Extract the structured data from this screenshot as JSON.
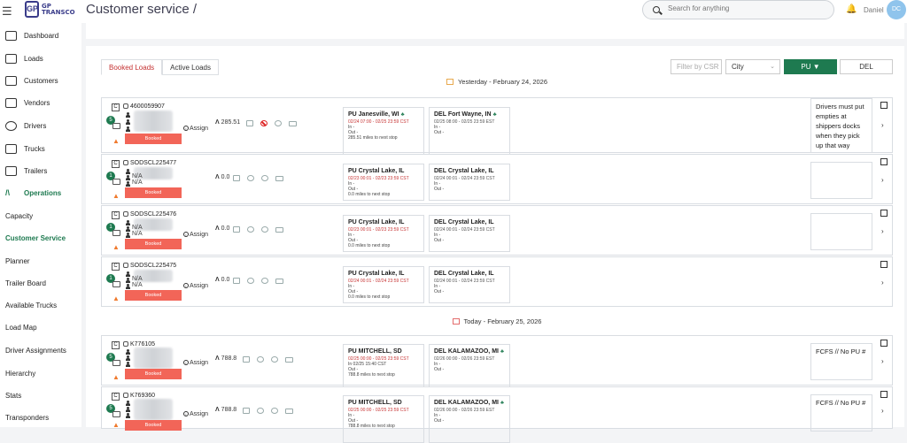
{
  "header": {
    "logo_letters": "GP",
    "logo_text_1": "GP",
    "logo_text_2": "TRANSCO",
    "page_title": "Customer service /",
    "search_placeholder": "Search for anything",
    "username": "Daniel",
    "avatar_initials": "DC"
  },
  "sidebar": {
    "items": [
      {
        "label": "Dashboard",
        "icon": "dashboard-icon"
      },
      {
        "label": "Loads",
        "icon": "loads-icon"
      },
      {
        "label": "Customers",
        "icon": "customers-icon"
      },
      {
        "label": "Vendors",
        "icon": "vendors-icon"
      },
      {
        "label": "Drivers",
        "icon": "drivers-icon"
      },
      {
        "label": "Trucks",
        "icon": "truck-icon"
      },
      {
        "label": "Trailers",
        "icon": "trailer-icon"
      },
      {
        "label": "Operations",
        "icon": "operations-icon"
      }
    ],
    "sub_items": [
      {
        "label": "Capacity"
      },
      {
        "label": "Customer Service"
      },
      {
        "label": "Planner"
      },
      {
        "label": "Trailer Board"
      },
      {
        "label": "Available Trucks"
      },
      {
        "label": "Load Map"
      },
      {
        "label": "Driver Assignments"
      },
      {
        "label": "Hierarchy"
      },
      {
        "label": "Stats"
      },
      {
        "label": "Transponders"
      }
    ]
  },
  "tabs": [
    {
      "label": "Booked Loads",
      "active": true
    },
    {
      "label": "Active Loads",
      "active": false
    }
  ],
  "filters": {
    "csr_placeholder": "Filter by CSR",
    "city_value": "City",
    "pu_label": "PU ▼",
    "del_label": "DEL"
  },
  "days": {
    "yesterday": "Yesterday - February 24, 2026",
    "today": "Today - February 25, 2026"
  },
  "rows": [
    {
      "id": "4600059907",
      "na": "",
      "badge": "5",
      "status": "Booked",
      "assign": "Assign",
      "miles": "285.51",
      "pu": {
        "title": "PU Janesville, WI",
        "time": "02/24 07:00 - 02/25 23:59 CST",
        "l1": "In -",
        "l2": "Out -",
        "l3": "285.51 miles to next stop"
      },
      "del": {
        "title": "DEL Fort Wayne, IN",
        "time": "02/25 08:00 - 02/25 23:59 EST",
        "l1": "In -",
        "l2": "Out -"
      },
      "note": "Drivers must put empties at shippers docks when they pick up that way"
    },
    {
      "id": "SODSCL225477",
      "na": "N/A",
      "badge": "1",
      "status": "Booked",
      "assign": "",
      "miles": "0.0",
      "pu": {
        "title": "PU Crystal Lake, IL",
        "time": "02/23 00:01 - 02/23 23:59 CST",
        "l1": "In -",
        "l2": "Out -",
        "l3": "0.0 miles to next stop"
      },
      "del": {
        "title": "DEL Crystal Lake, IL",
        "time": "02/24 00:01 - 02/24 23:59 CST",
        "l1": "In -",
        "l2": "Out -"
      },
      "note": ""
    },
    {
      "id": "SODSCL225476",
      "na": "N/A",
      "badge": "1",
      "status": "Booked",
      "assign": "Assign",
      "miles": "0.0",
      "pu": {
        "title": "PU Crystal Lake, IL",
        "time": "02/23 00:01 - 02/23 23:59 CST",
        "l1": "In -",
        "l2": "Out -",
        "l3": "0.0 miles to next stop"
      },
      "del": {
        "title": "DEL Crystal Lake, IL",
        "time": "02/24 00:01 - 02/24 23:59 CST",
        "l1": "In -",
        "l2": "Out -"
      },
      "note": ""
    },
    {
      "id": "SODSCL225475",
      "na": "N/A",
      "badge": "1",
      "status": "Booked",
      "assign": "Assign",
      "miles": "0.0",
      "pu": {
        "title": "PU Crystal Lake, IL",
        "time": "02/24 00:01 - 02/24 23:59 CST",
        "l1": "In -",
        "l2": "Out -",
        "l3": "0.0 miles to next stop"
      },
      "del": {
        "title": "DEL Crystal Lake, IL",
        "time": "02/24 00:01 - 02/24 23:59 CST",
        "l1": "In -",
        "l2": "Out -"
      },
      "note": ""
    },
    {
      "id": "K776105",
      "na": "",
      "badge": "5",
      "status": "Booked",
      "assign": "Assign",
      "miles": "788.8",
      "pu": {
        "title": "PU MITCHELL, SD",
        "time": "02/25 00:00 - 02/25 23:59 CST",
        "l1": "In 02/25 15:40 CST",
        "l2": "Out -",
        "l3": "788.8 miles to next stop"
      },
      "del": {
        "title": "DEL KALAMAZOO, MI",
        "time": "02/26 00:00 - 02/26 23:59 EST",
        "l1": "In -",
        "l2": "Out -"
      },
      "note": "FCFS // No PU #"
    },
    {
      "id": "K769360",
      "na": "",
      "badge": "5",
      "status": "Booked",
      "assign": "Assign",
      "miles": "788.8",
      "pu": {
        "title": "PU MITCHELL, SD",
        "time": "02/25 00:00 - 02/25 23:59 CST",
        "l1": "In -",
        "l2": "Out -",
        "l3": "788.8 miles to next stop"
      },
      "del": {
        "title": "DEL KALAMAZOO, MI",
        "time": "02/26 00:00 - 02/26 23:59 EST",
        "l1": "In -",
        "l2": "Out -"
      },
      "note": "FCFS // No PU #"
    }
  ],
  "colors": {
    "accent": "#1e7a50",
    "booked": "#f26558",
    "time_red": "#c73535"
  }
}
